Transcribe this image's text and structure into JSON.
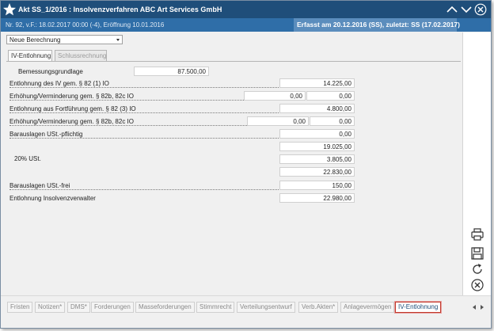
{
  "window": {
    "title": "Akt SS_1/2016 : Insolvenzverfahren ABC Art Services GmbH",
    "subtitle": "Nr. 92, v.F.: 18.02.2017 00:00 (-4), Eröffnung 10.01.2016",
    "recorded": "Erfasst am 20.12.2016 (SS), zuletzt: SS (17.02.2017)"
  },
  "calc_select": {
    "value": "Neue Berechnung"
  },
  "tabs": [
    {
      "label": "IV-Entlohnung",
      "active": true
    },
    {
      "label": "Schlussrechnung",
      "active": false
    }
  ],
  "form": {
    "basis": {
      "label": "Bemessungsgrundlage",
      "value": "87.500,00"
    },
    "rows": [
      {
        "label": "Entlohnung des IV gem. § 82 (1) IO",
        "value": "14.225,00"
      },
      {
        "label": "Erhöhung/Verminderung gem. § 82b, 82c IO",
        "percent": "0,00",
        "value": "0,00"
      },
      {
        "label": "Entlohnung aus Fortführung gem. § 82 (3) IO",
        "value": "4.800,00"
      },
      {
        "label": "Erhöhung/Verminderung gem. § 82b, 82c IO",
        "percent": "0,00",
        "value": "0,00"
      },
      {
        "label": "Barauslagen USt.-pflichtig",
        "value": "0,00"
      },
      {
        "label": "",
        "value": "19.025,00"
      },
      {
        "label": "20% USt.",
        "value": "3.805,00"
      },
      {
        "label": "",
        "value": "22.830,00"
      },
      {
        "label": "Barauslagen USt.-frei",
        "value": "150,00"
      },
      {
        "label": "Entlohnung Insolvenzverwalter",
        "value": "22.980,00"
      }
    ]
  },
  "side_actions": [
    "printer-icon",
    "save-icon",
    "refresh-icon",
    "close-circle-icon"
  ],
  "bottom_tabs": [
    {
      "label": "Fristen"
    },
    {
      "label": "Notizen*"
    },
    {
      "label": "DMS*"
    },
    {
      "label": "Forderungen"
    },
    {
      "label": "Masseforderungen"
    },
    {
      "label": "Stimmrecht"
    },
    {
      "label": "Verteilungsentwurf"
    },
    {
      "label": "Verb.Akten*"
    },
    {
      "label": "Anlagevermögen"
    },
    {
      "label": "IV-Entlohnung",
      "active": true
    }
  ],
  "colors": {
    "titlebar": "#1f4e7a",
    "subbar": "#2f6ea8",
    "subbar_highlight": "#5b8dbd",
    "active_tab_border": "#c0392b"
  }
}
